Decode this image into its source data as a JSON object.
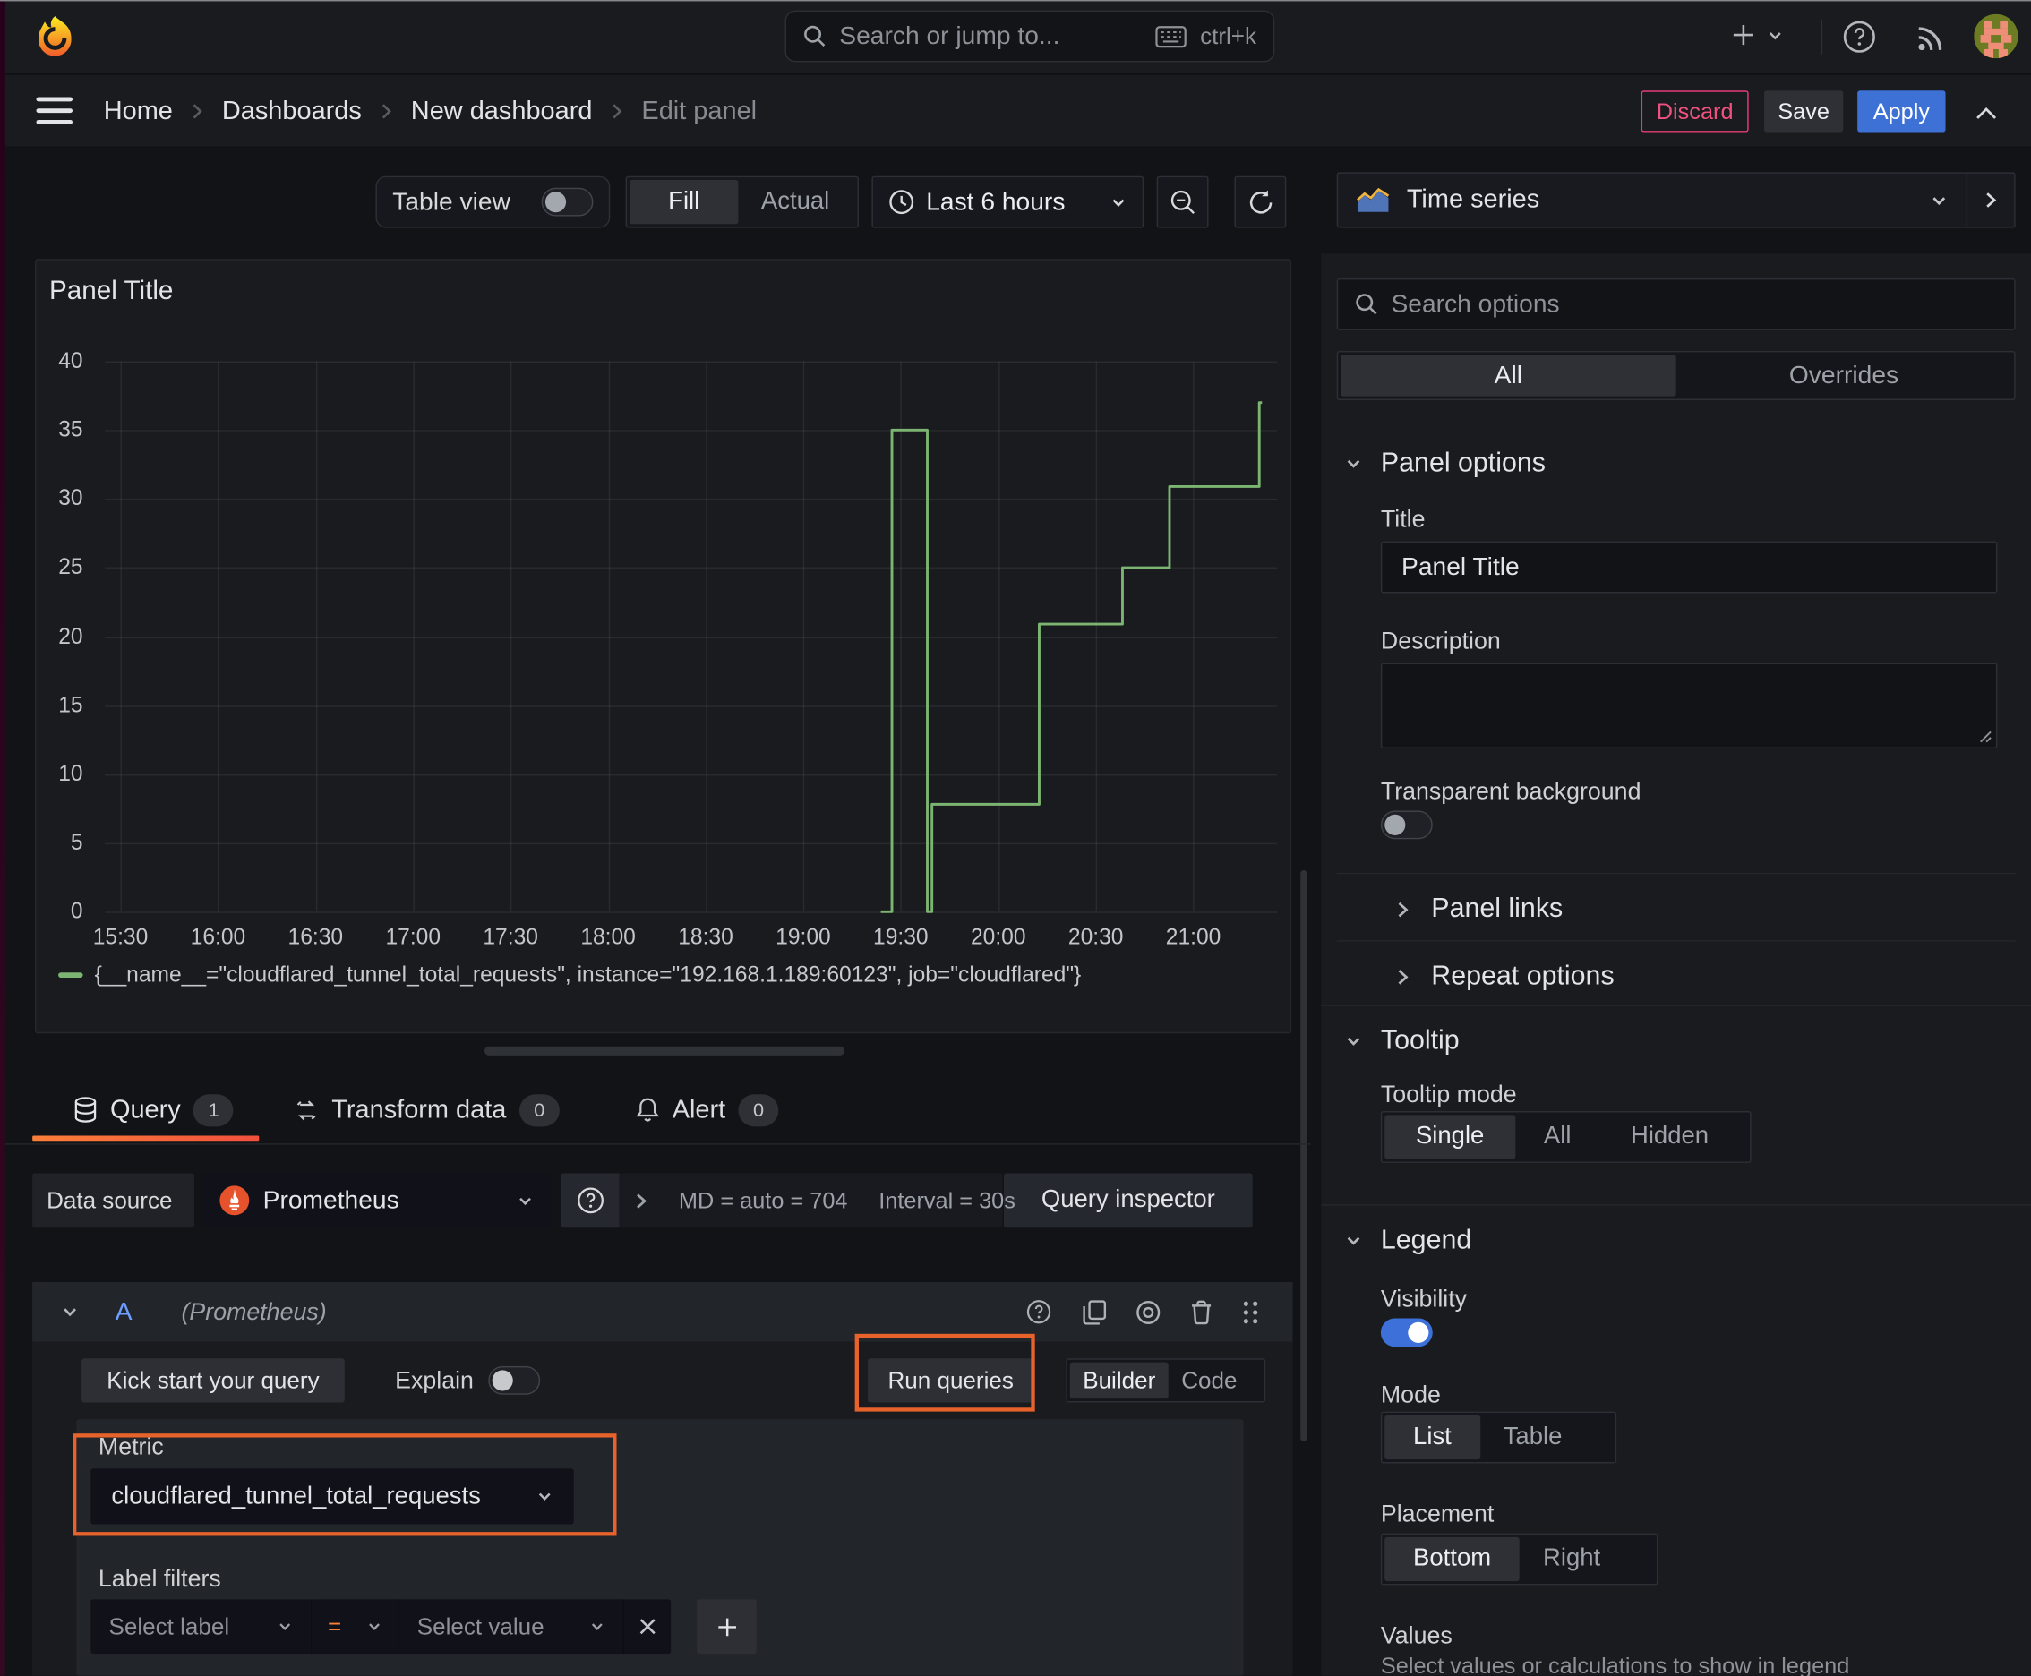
{
  "colors": {
    "accent_orange": "#fa7f39",
    "underline_from": "#fa7f39",
    "underline_to": "#f1503c",
    "blue": "#3e71d6",
    "pink": "#ea3d73",
    "green": "#7cb571",
    "annotation": "#e8632c",
    "toggle_on": "#3d71d9"
  },
  "topbar": {
    "search_placeholder": "Search or jump to...",
    "shortcut": "ctrl+k"
  },
  "breadcrumb": {
    "items": [
      "Home",
      "Dashboards",
      "New dashboard",
      "Edit panel"
    ],
    "discard": "Discard",
    "save": "Save",
    "apply": "Apply"
  },
  "toolbar": {
    "table_view": "Table view",
    "fill": "Fill",
    "actual": "Actual",
    "time_range": "Last 6 hours"
  },
  "panel": {
    "title": "Panel Title"
  },
  "chart_data": {
    "type": "line",
    "step": true,
    "title": "Panel Title",
    "xlabel": "",
    "ylabel": "",
    "ylim": [
      0,
      40
    ],
    "grid": true,
    "legend_position": "bottom",
    "y_ticks": [
      0,
      5,
      10,
      15,
      20,
      25,
      30,
      35,
      40
    ],
    "x_tick_hours": [
      15.5,
      16,
      16.5,
      17,
      17.5,
      18,
      18.5,
      19,
      19.5,
      20,
      20.5,
      21
    ],
    "x_tick_labels": [
      "15:30",
      "16:00",
      "16:30",
      "17:00",
      "17:30",
      "18:00",
      "18:30",
      "19:00",
      "19:30",
      "20:00",
      "20:30",
      "21:00"
    ],
    "series": [
      {
        "name": "{__name__=\"cloudflared_tunnel_total_requests\", instance=\"192.168.1.189:60123\", job=\"cloudflared\"}",
        "color": "#7cb571",
        "points_hours_value": [
          [
            19.398,
            0
          ],
          [
            19.455,
            0
          ],
          [
            19.455,
            35
          ],
          [
            19.636,
            35
          ],
          [
            19.636,
            0
          ],
          [
            19.66,
            0
          ],
          [
            19.66,
            7.8
          ],
          [
            20.21,
            7.8
          ],
          [
            20.21,
            20.9
          ],
          [
            20.637,
            20.9
          ],
          [
            20.637,
            25
          ],
          [
            20.878,
            25
          ],
          [
            20.878,
            30.9
          ],
          [
            21.338,
            30.9
          ],
          [
            21.338,
            37
          ],
          [
            21.352,
            37
          ]
        ]
      }
    ]
  },
  "tabs": {
    "query": "Query",
    "query_count": "1",
    "transform": "Transform data",
    "transform_count": "0",
    "alert": "Alert",
    "alert_count": "0"
  },
  "datasource": {
    "label": "Data source",
    "name": "Prometheus",
    "stats_md": "MD = auto = 704",
    "stats_interval": "Interval = 30s",
    "inspector": "Query inspector"
  },
  "query": {
    "ref": "A",
    "ds": "(Prometheus)",
    "kickstart": "Kick start your query",
    "explain": "Explain",
    "run": "Run queries",
    "builder": "Builder",
    "code": "Code",
    "metric_label": "Metric",
    "metric_value": "cloudflared_tunnel_total_requests",
    "label_filters": "Label filters",
    "select_label": "Select label",
    "op": "=",
    "select_value": "Select value"
  },
  "viz": {
    "name": "Time series"
  },
  "options": {
    "search_placeholder": "Search options",
    "tab_all": "All",
    "tab_overrides": "Overrides",
    "panel_options": "Panel options",
    "title_label": "Title",
    "title_value": "Panel Title",
    "description_label": "Description",
    "transparent": "Transparent background",
    "panel_links": "Panel links",
    "repeat_options": "Repeat options",
    "tooltip": "Tooltip",
    "tooltip_mode": "Tooltip mode",
    "single": "Single",
    "all": "All",
    "hidden": "Hidden",
    "legend": "Legend",
    "visibility": "Visibility",
    "mode": "Mode",
    "list": "List",
    "table": "Table",
    "placement": "Placement",
    "bottom": "Bottom",
    "right": "Right",
    "values_label": "Values",
    "values_desc": "Select values or calculations to show in legend"
  }
}
